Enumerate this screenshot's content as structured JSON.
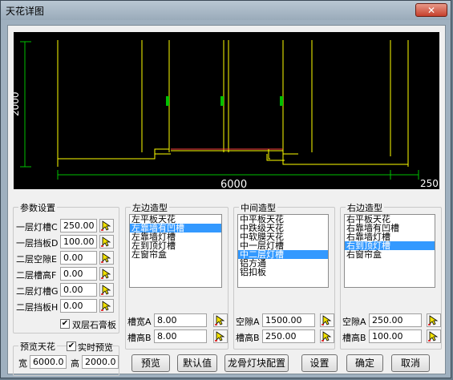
{
  "window": {
    "title": "天花详图",
    "close_glyph": "✕"
  },
  "preview": {
    "dim_vertical": "2000",
    "dim_width": "6000",
    "dim_right": "250"
  },
  "params": {
    "title": "参数设置",
    "rows": [
      {
        "label": "一层灯槽C",
        "value": "250.00"
      },
      {
        "label": "一层挡板D",
        "value": "100.00"
      },
      {
        "label": "二层空隙E",
        "value": "0.00"
      },
      {
        "label": "二层槽高F",
        "value": "0.00"
      },
      {
        "label": "二层灯槽G",
        "value": "0.00"
      },
      {
        "label": "二层挡板H",
        "value": "0.00"
      }
    ],
    "double_gypsum_label": "双层石膏板",
    "double_gypsum_checked": true
  },
  "preview_ceiling": {
    "title": "预览天花",
    "realtime_label": "实时预览",
    "realtime_checked": true,
    "width_label": "宽",
    "width_value": "6000.00",
    "height_label": "高",
    "height_value": "2000.00"
  },
  "left": {
    "title": "左边造型",
    "items": [
      "左平板天花",
      "左靠墙有凹槽",
      "左靠墙灯槽",
      "左到顶灯槽",
      "左窗帘盒"
    ],
    "selected_index": 1,
    "fields": [
      {
        "label": "槽宽A",
        "value": "8.00"
      },
      {
        "label": "槽高B",
        "value": "8.00"
      }
    ]
  },
  "middle": {
    "title": "中间造型",
    "items": [
      "中平板天花",
      "中跌级天花",
      "中软膜天花",
      "中一层灯槽",
      "中二层灯槽",
      "铝方通",
      "铝扣板"
    ],
    "selected_index": 4,
    "fields": [
      {
        "label": "空隙A",
        "value": "1500.00"
      },
      {
        "label": "槽高B",
        "value": "250.00"
      }
    ]
  },
  "right": {
    "title": "右边造型",
    "items": [
      "右平板天花",
      "右靠墙有凹槽",
      "右靠墙灯槽",
      "右到顶灯槽",
      "右窗帘盒"
    ],
    "selected_index": 3,
    "fields": [
      {
        "label": "空隙A",
        "value": "250.00"
      },
      {
        "label": "槽高B",
        "value": "100.00"
      }
    ]
  },
  "buttons": {
    "preview": "预览",
    "default": "默认值",
    "keel_config": "龙骨灯块配置",
    "settings": "设置",
    "ok": "确定",
    "cancel": "取消"
  },
  "colors": {
    "selection": "#3399ff",
    "cad_yellow": "#ffff00",
    "cad_green": "#00c000"
  }
}
